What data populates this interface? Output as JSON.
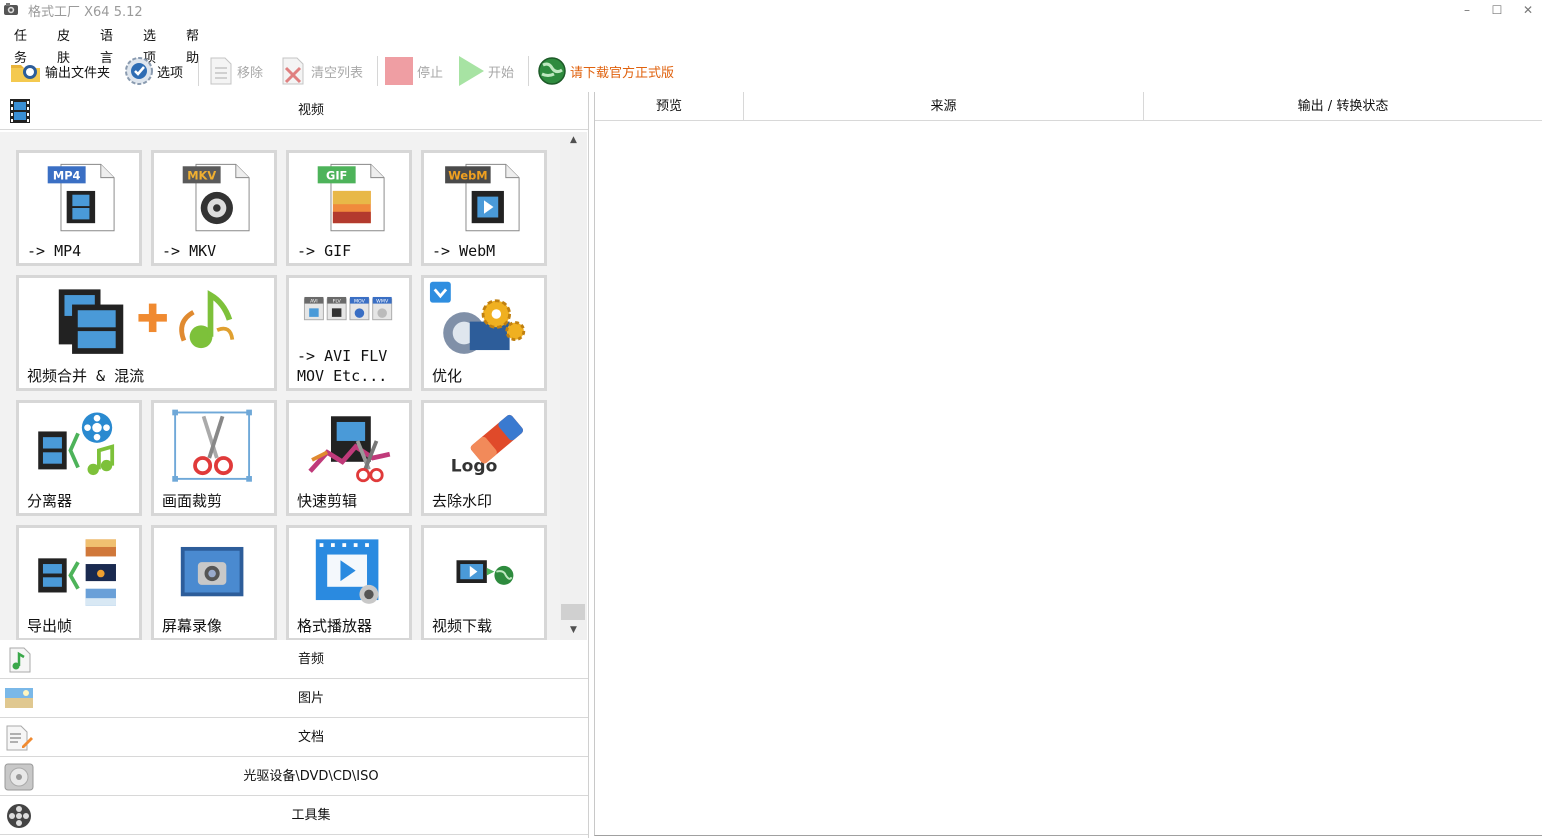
{
  "window": {
    "title": "格式工厂 X64 5.12",
    "controls": {
      "minimize": "–",
      "maximize": "☐",
      "close": "✕"
    }
  },
  "menu": [
    "任务",
    "皮肤",
    "语言",
    "选项",
    "帮助"
  ],
  "toolbar": {
    "output_folder": "输出文件夹",
    "options": "选项",
    "remove": "移除",
    "clear_list": "清空列表",
    "stop": "停止",
    "start": "开始",
    "download_official": "请下载官方正式版"
  },
  "categories": {
    "video": "视频",
    "audio": "音频",
    "image": "图片",
    "document": "文档",
    "optical": "光驱设备\\DVD\\CD\\ISO",
    "tools": "工具集"
  },
  "tiles": {
    "mp4": {
      "label": "-> MP4",
      "badge": "MP4"
    },
    "mkv": {
      "label": "-> MKV",
      "badge": "MKV"
    },
    "gif": {
      "label": "-> GIF",
      "badge": "GIF"
    },
    "webm": {
      "label": "-> WebM",
      "badge": "WebM"
    },
    "merge": {
      "label": "视频合并 & 混流"
    },
    "avi": {
      "label": "-> AVI FLV\nMOV Etc...",
      "mini_badges": [
        "AVI",
        "FLV",
        "MOV",
        "WMV"
      ]
    },
    "optimize": {
      "label": "优化"
    },
    "splitter": {
      "label": "分离器"
    },
    "crop": {
      "label": "画面裁剪"
    },
    "quick_cut": {
      "label": "快速剪辑"
    },
    "watermark": {
      "label": "去除水印",
      "logo_text": "Logo"
    },
    "export_frames": {
      "label": "导出帧"
    },
    "screen_record": {
      "label": "屏幕录像"
    },
    "player": {
      "label": "格式播放器"
    },
    "video_download": {
      "label": "视频下载"
    }
  },
  "table": {
    "columns": [
      "预览",
      "来源",
      "输出 / 转换状态"
    ]
  },
  "colors": {
    "accent_orange": "#e0620e",
    "tile_border": "#d7d7d7",
    "grid_bg": "#f2f2f2"
  }
}
